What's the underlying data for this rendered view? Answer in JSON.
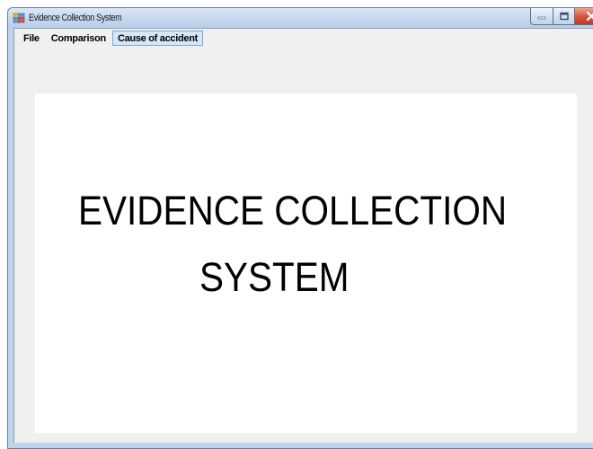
{
  "window": {
    "title": "Evidence Collection System",
    "icon": "app-icon",
    "caption_buttons": {
      "minimize_icon": "minimize-icon",
      "maximize_icon": "maximize-icon",
      "close_icon": "close-icon"
    }
  },
  "menubar": {
    "items": [
      {
        "label": "File",
        "active": false
      },
      {
        "label": "Comparison",
        "active": false
      },
      {
        "label": "Cause of accident",
        "active": true
      }
    ]
  },
  "main": {
    "headline_line1": "EVIDENCE COLLECTION",
    "headline_line2": "SYSTEM"
  },
  "colors": {
    "client_background": "#f0f0f0",
    "panel_background": "#ffffff",
    "menu_highlight": "#d5e6f7",
    "menu_highlight_border": "#7aa7d6",
    "close_button": "#c23a1d"
  }
}
